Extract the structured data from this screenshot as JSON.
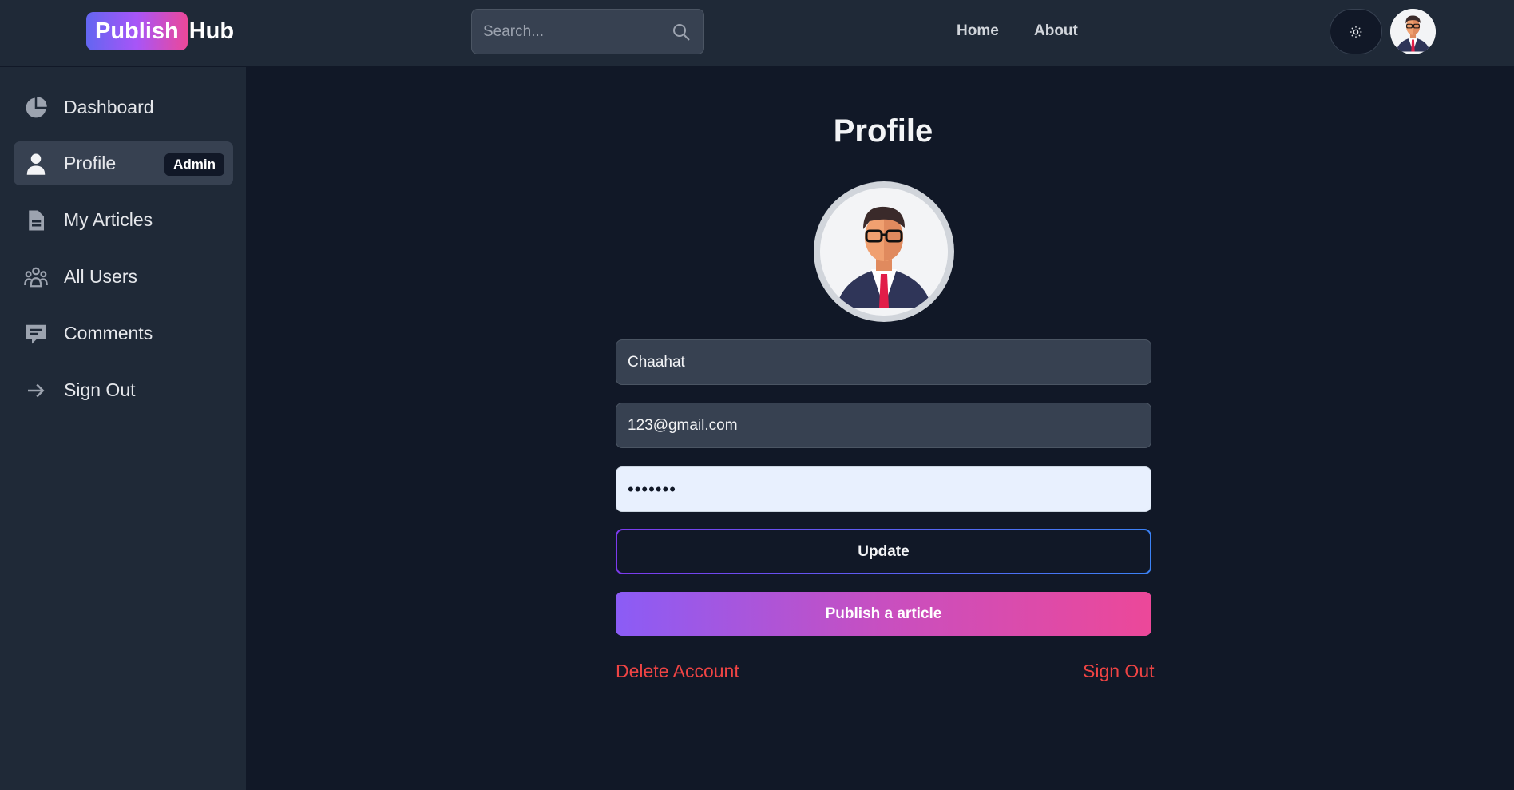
{
  "header": {
    "logo_highlight": "Publish",
    "logo_rest": "Hub",
    "search_placeholder": "Search...",
    "nav": [
      {
        "label": "Home"
      },
      {
        "label": "About"
      }
    ],
    "theme_icon": "sun-icon"
  },
  "sidebar": {
    "items": [
      {
        "label": "Dashboard",
        "icon": "pie-chart-icon"
      },
      {
        "label": "Profile",
        "icon": "user-icon",
        "badge": "Admin",
        "active": true
      },
      {
        "label": "My Articles",
        "icon": "document-icon"
      },
      {
        "label": "All Users",
        "icon": "users-group-icon"
      },
      {
        "label": "Comments",
        "icon": "chat-icon"
      },
      {
        "label": "Sign Out",
        "icon": "arrow-right-icon"
      }
    ]
  },
  "main": {
    "title": "Profile",
    "username": "Chaahat",
    "email": "123@gmail.com",
    "password": "•••••••",
    "update_label": "Update",
    "publish_label": "Publish a article",
    "delete_label": "Delete Account",
    "signout_label": "Sign Out"
  },
  "colors": {
    "background": "#111827",
    "panel": "#1f2937",
    "accent_start": "#8b5cf6",
    "accent_end": "#ec4899",
    "danger": "#ef4444"
  }
}
